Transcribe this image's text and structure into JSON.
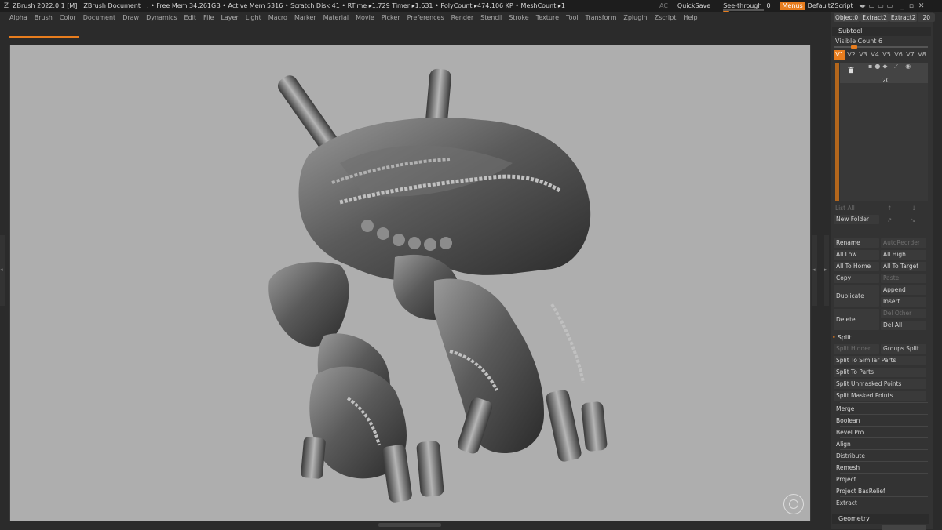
{
  "titlebar": {
    "app": "ZBrush 2022.0.1 [M]",
    "document": "ZBrush Document",
    "status": ". • Free Mem 34.261GB • Active Mem 5316 • Scratch Disk 41 • RTime ▸1.729 Timer ▸1.631 • PolyCount ▸474.106 KP • MeshCount ▸1",
    "ac": "AC",
    "quicksave": "QuickSave",
    "see_through_label": "See-through",
    "see_through_value": "0",
    "menus": "Menus",
    "script": "DefaultZScript",
    "accent": "#e87d1e"
  },
  "menubar": [
    "Alpha",
    "Brush",
    "Color",
    "Document",
    "Draw",
    "Dynamics",
    "Edit",
    "File",
    "Layer",
    "Light",
    "Macro",
    "Marker",
    "Material",
    "Movie",
    "Picker",
    "Preferences",
    "Render",
    "Stencil",
    "Stroke",
    "Texture",
    "Tool",
    "Transform",
    "Zplugin",
    "Zscript",
    "Help"
  ],
  "panel": {
    "top_buttons": [
      "Object0",
      "Extract2",
      "Extract2"
    ],
    "top_number": "20",
    "subtool_title": "Subtool",
    "visible_count": "Visible Count 6",
    "visible_count_level": 0.2,
    "version_tabs": [
      "V1",
      "V2",
      "V3",
      "V4",
      "V5",
      "V6",
      "V7",
      "V8"
    ],
    "active_version": "V1",
    "subtool_number": "20",
    "list_all": "List All",
    "new_folder": "New Folder",
    "rename": "Rename",
    "auto_reorder": "AutoReorder",
    "all_low": "All Low",
    "all_high": "All High",
    "all_to_home": "All To Home",
    "all_to_target": "All To Target",
    "copy": "Copy",
    "paste": "Paste",
    "duplicate": "Duplicate",
    "append": "Append",
    "insert": "Insert",
    "delete": "Delete",
    "del_other": "Del Other",
    "del_all": "Del All",
    "split": "Split",
    "split_hidden": "Split Hidden",
    "groups_split": "Groups Split",
    "split_similar": "Split To Similar Parts",
    "split_parts": "Split To Parts",
    "split_unmasked": "Split Unmasked Points",
    "split_masked": "Split Masked Points",
    "merge": "Merge",
    "boolean": "Boolean",
    "bevel_pro": "Bevel Pro",
    "align": "Align",
    "distribute": "Distribute",
    "remesh": "Remesh",
    "project": "Project",
    "project_basrelief": "Project BasRelief",
    "extract": "Extract",
    "geometry": "Geometry"
  },
  "viewport": {
    "background": "#aeaeae",
    "model": "mech-robot-model"
  }
}
